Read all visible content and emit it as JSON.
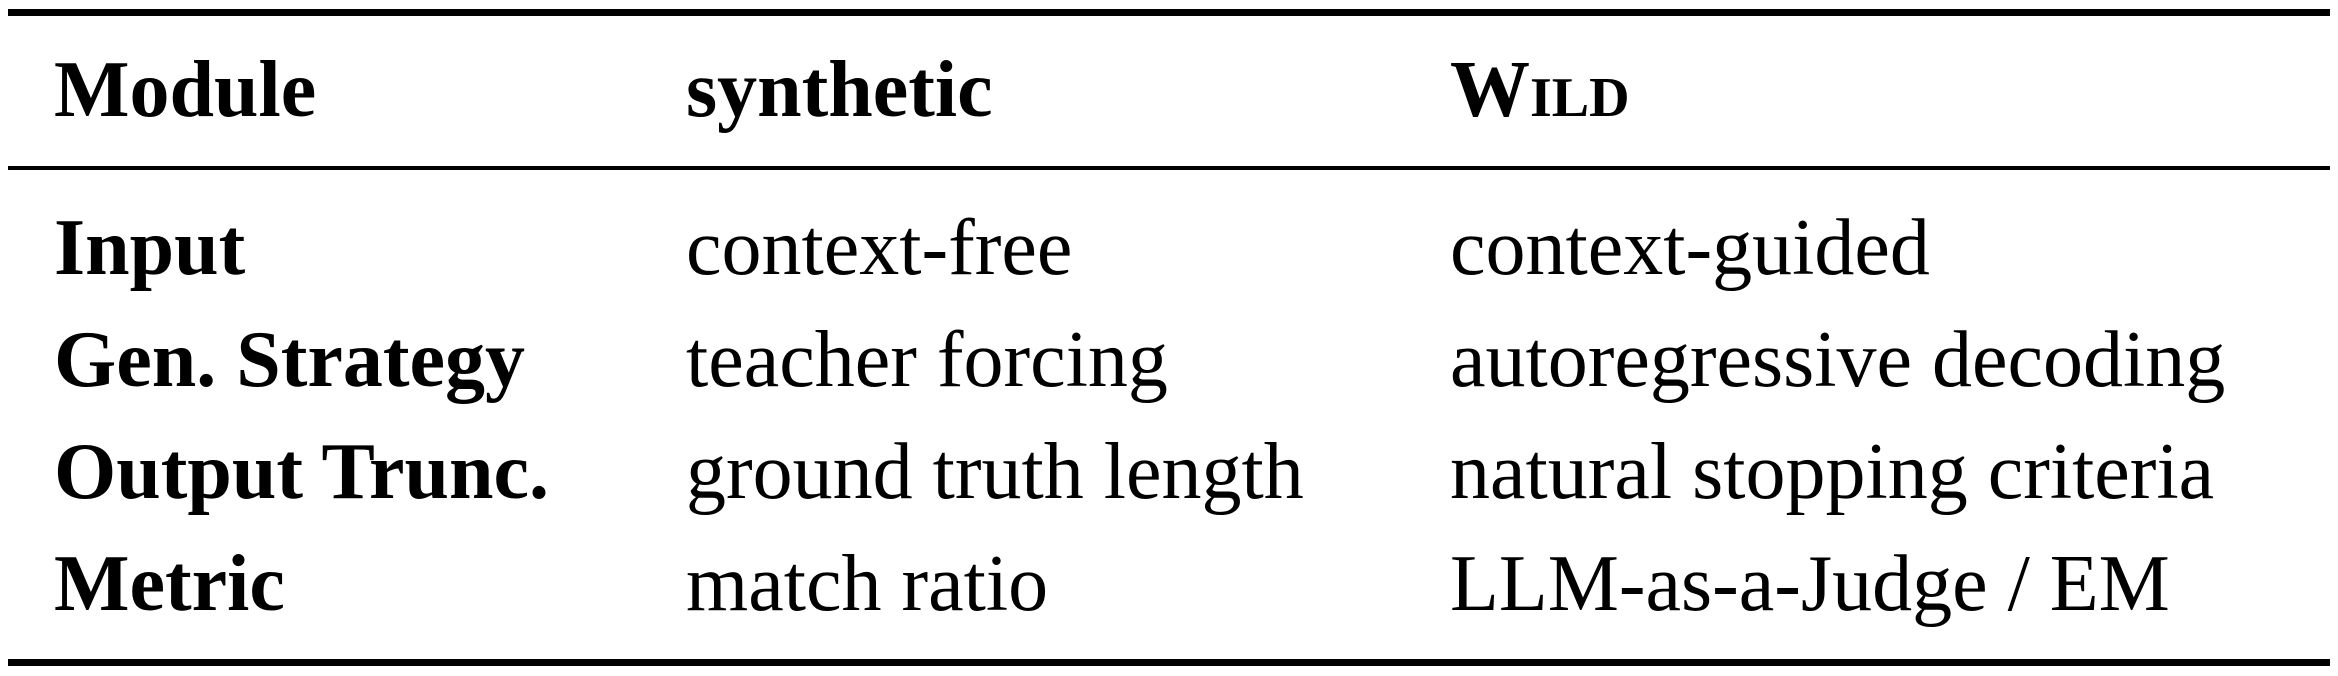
{
  "table": {
    "headers": {
      "module": "Module",
      "synthetic": "synthetic",
      "wild": "Wild"
    },
    "rows": [
      {
        "module": "Input",
        "synthetic": "context-free",
        "wild": "context-guided"
      },
      {
        "module": "Gen. Strategy",
        "synthetic": "teacher forcing",
        "wild": "autoregressive decoding"
      },
      {
        "module": "Output Trunc.",
        "synthetic": "ground truth length",
        "wild": "natural stopping criteria"
      },
      {
        "module": "Metric",
        "synthetic": "match ratio",
        "wild": "LLM-as-a-Judge / EM"
      }
    ]
  }
}
